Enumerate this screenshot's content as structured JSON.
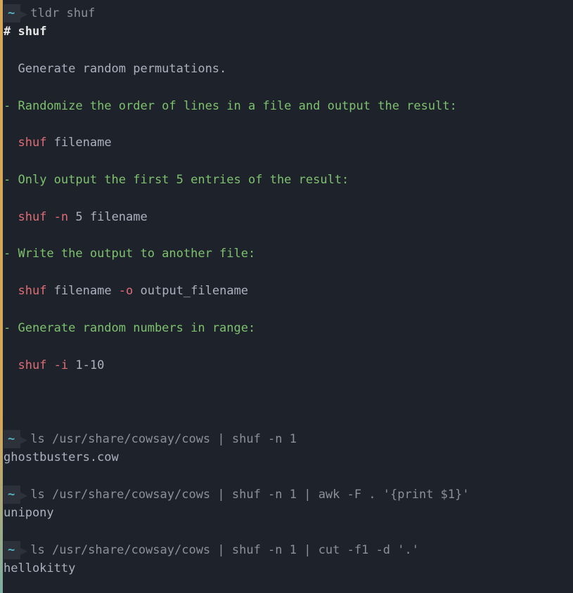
{
  "prompts": [
    {
      "tilde": "~",
      "command": "tldr shuf"
    },
    {
      "tilde": "~",
      "command": "ls /usr/share/cowsay/cows | shuf -n 1"
    },
    {
      "tilde": "~",
      "command": "ls /usr/share/cowsay/cows | shuf -n 1 | awk -F . '{print $1}'"
    },
    {
      "tilde": "~",
      "command": "ls /usr/share/cowsay/cows | shuf -n 1 | cut -f1 -d '.'"
    }
  ],
  "tldr": {
    "header_hash": "# ",
    "header_name": "shuf",
    "description": "  Generate random permutations.",
    "examples": [
      {
        "dash": "- ",
        "desc": "Randomize the order of lines in a file and output the result:",
        "cmd_parts": {
          "indent": "  ",
          "cmd": "shuf",
          "args": " filename"
        }
      },
      {
        "dash": "- ",
        "desc": "Only output the first 5 entries of the result:",
        "cmd_parts": {
          "indent": "  ",
          "cmd": "shuf",
          "flag": " -n",
          "args": " 5 filename"
        }
      },
      {
        "dash": "- ",
        "desc": "Write the output to another file:",
        "cmd_parts": {
          "indent": "  ",
          "cmd": "shuf",
          "mid": " filename ",
          "flag": "-o",
          "args": " output_filename"
        }
      },
      {
        "dash": "- ",
        "desc": "Generate random numbers in range:",
        "cmd_parts": {
          "indent": "  ",
          "cmd": "shuf",
          "flag": " -i",
          "args": " 1-10"
        }
      }
    ]
  },
  "outputs": [
    "ghostbusters.cow",
    "unipony",
    "hellokitty"
  ]
}
